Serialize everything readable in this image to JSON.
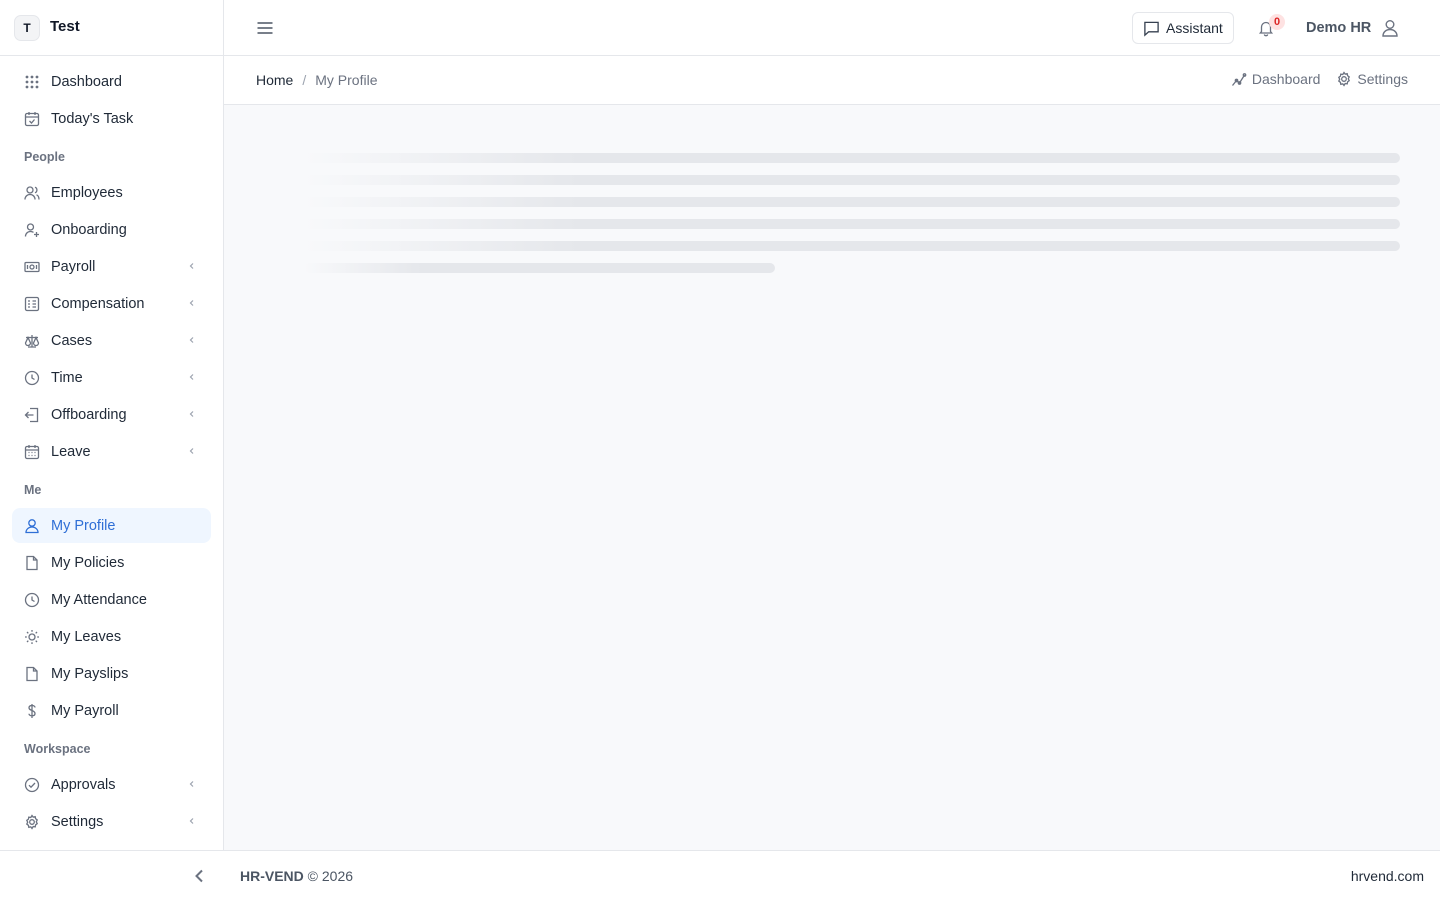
{
  "brand": {
    "initial": "T",
    "name": "Test"
  },
  "nav": {
    "top": [
      {
        "label": "Dashboard",
        "icon": "grid-icon"
      },
      {
        "label": "Today's Task",
        "icon": "calendar-check-icon"
      }
    ],
    "people_title": "People",
    "people": [
      {
        "label": "Employees",
        "icon": "users-icon"
      },
      {
        "label": "Onboarding",
        "icon": "user-plus-icon"
      },
      {
        "label": "Payroll",
        "icon": "banknote-icon",
        "expandable": true
      },
      {
        "label": "Compensation",
        "icon": "sheet-icon",
        "expandable": true
      },
      {
        "label": "Cases",
        "icon": "scale-icon",
        "expandable": true
      },
      {
        "label": "Time",
        "icon": "clock-icon",
        "expandable": true
      },
      {
        "label": "Offboarding",
        "icon": "logout-icon",
        "expandable": true
      },
      {
        "label": "Leave",
        "icon": "calendar-icon",
        "expandable": true
      }
    ],
    "me_title": "Me",
    "me": [
      {
        "label": "My Profile",
        "icon": "user-icon",
        "active": true
      },
      {
        "label": "My Policies",
        "icon": "file-icon"
      },
      {
        "label": "My Attendance",
        "icon": "clock-icon"
      },
      {
        "label": "My Leaves",
        "icon": "sun-icon"
      },
      {
        "label": "My Payslips",
        "icon": "file-icon"
      },
      {
        "label": "My Payroll",
        "icon": "dollar-icon"
      }
    ],
    "workspace_title": "Workspace",
    "workspace": [
      {
        "label": "Approvals",
        "icon": "check-circle-icon",
        "expandable": true
      },
      {
        "label": "Settings",
        "icon": "gear-icon",
        "expandable": true
      }
    ]
  },
  "header": {
    "assistant_label": "Assistant",
    "notification_count": "0",
    "user_name": "Demo HR"
  },
  "breadcrumb": {
    "home": "Home",
    "separator": "/",
    "current": "My Profile"
  },
  "quick_links": {
    "dashboard": "Dashboard",
    "settings": "Settings"
  },
  "footer": {
    "brand": "HR-VEND",
    "copyright": "© 2026",
    "site": "hrvend.com"
  },
  "colors": {
    "accent": "#2f6fd6",
    "active_bg": "#eff6ff",
    "badge_bg": "#fee2e2",
    "badge_text": "#dc2626",
    "main_bg": "#f8f9fb"
  }
}
